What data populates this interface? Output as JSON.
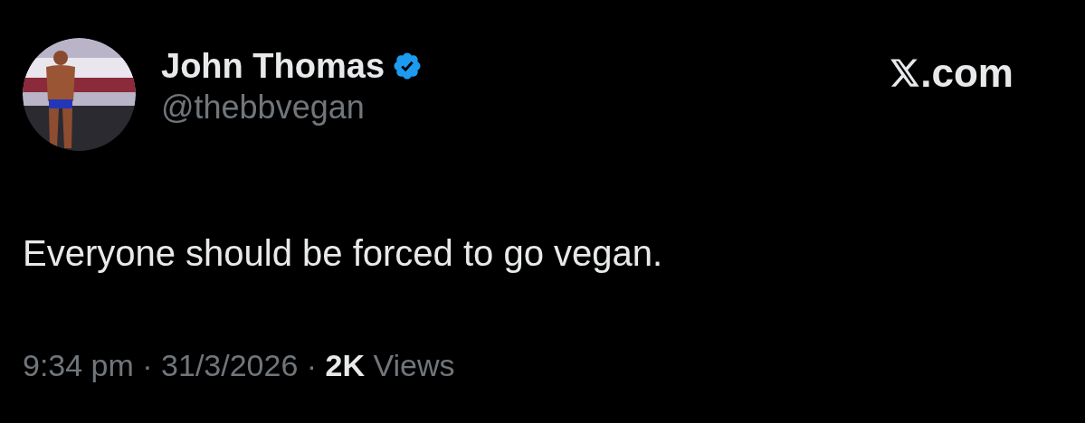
{
  "author": {
    "name": "John Thomas",
    "verified": true,
    "handle": "@thebbvegan"
  },
  "site": {
    "suffix": ".com"
  },
  "tweet": {
    "text": "Everyone should be forced to go vegan."
  },
  "meta": "9:34 pm · 31/3/2026 · **2K** Views"
}
